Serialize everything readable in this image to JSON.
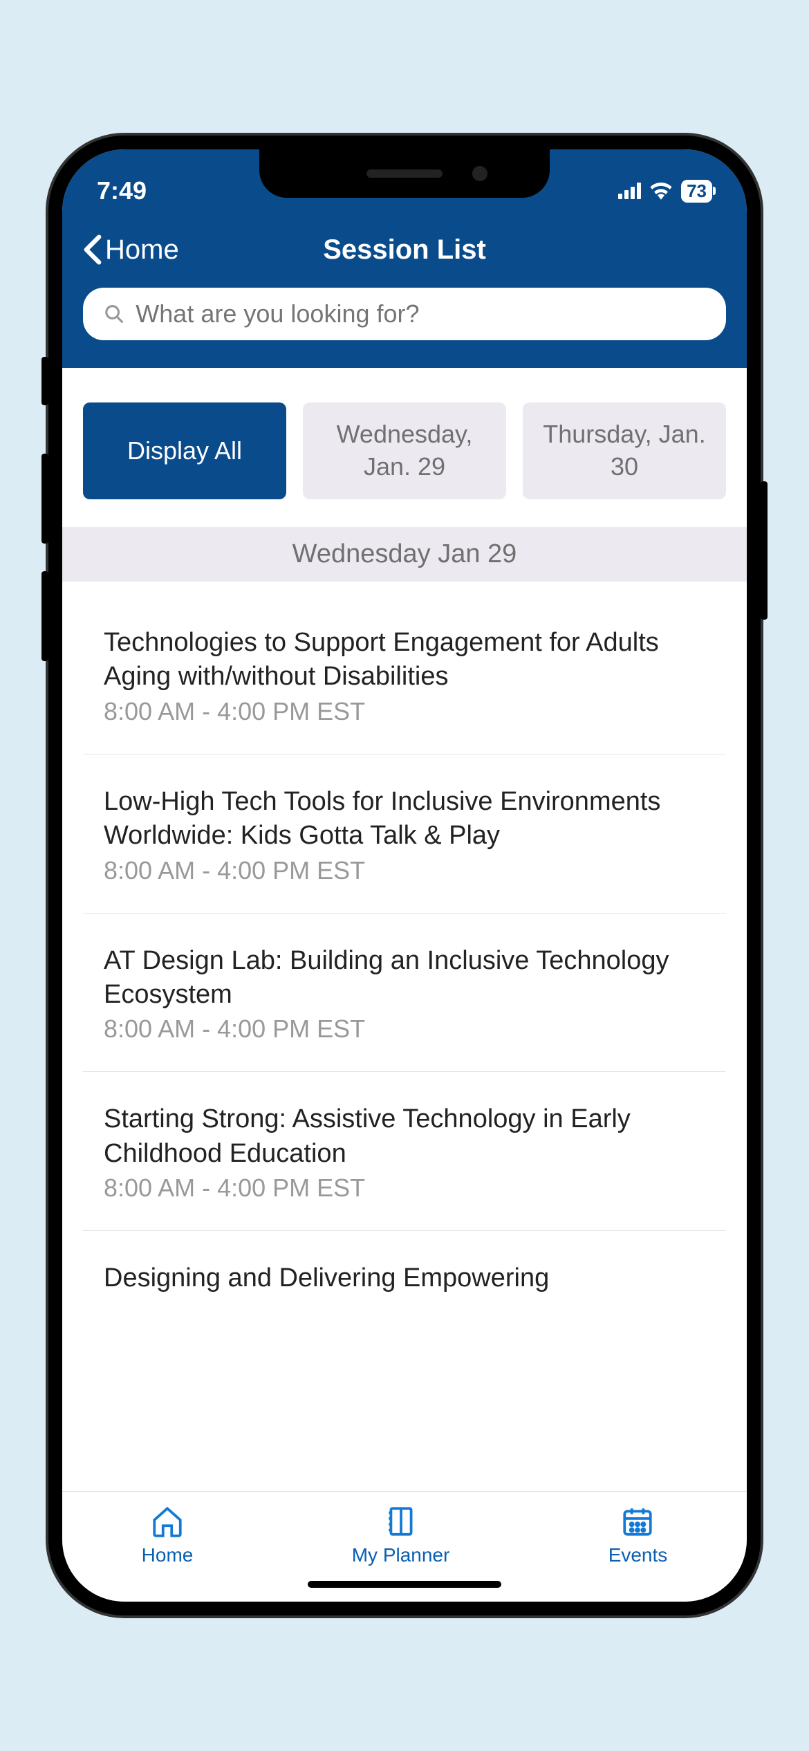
{
  "statusbar": {
    "time": "7:49",
    "battery": "73"
  },
  "nav": {
    "back_label": "Home",
    "title": "Session List"
  },
  "search": {
    "placeholder": "What are you looking for?"
  },
  "tabs": [
    {
      "label": "Display All",
      "active": true
    },
    {
      "label": "Wednesday, Jan. 29",
      "active": false
    },
    {
      "label": "Thursday, Jan. 30",
      "active": false
    }
  ],
  "date_header": "Wednesday Jan 29",
  "sessions": [
    {
      "title": "Technologies to Support Engagement for Adults Aging with/without Disabilities",
      "time": "8:00 AM - 4:00 PM EST"
    },
    {
      "title": "Low-High Tech Tools for Inclusive Environments Worldwide: Kids Gotta Talk & Play",
      "time": "8:00 AM - 4:00 PM EST"
    },
    {
      "title": "AT Design Lab: Building an Inclusive Technology Ecosystem",
      "time": "8:00 AM - 4:00 PM EST"
    },
    {
      "title": "Starting Strong: Assistive Technology in Early Childhood Education",
      "time": "8:00 AM - 4:00 PM EST"
    },
    {
      "title": "Designing and Delivering Empowering",
      "time": ""
    }
  ],
  "bottom_tabs": [
    {
      "label": "Home"
    },
    {
      "label": "My Planner"
    },
    {
      "label": "Events"
    }
  ]
}
